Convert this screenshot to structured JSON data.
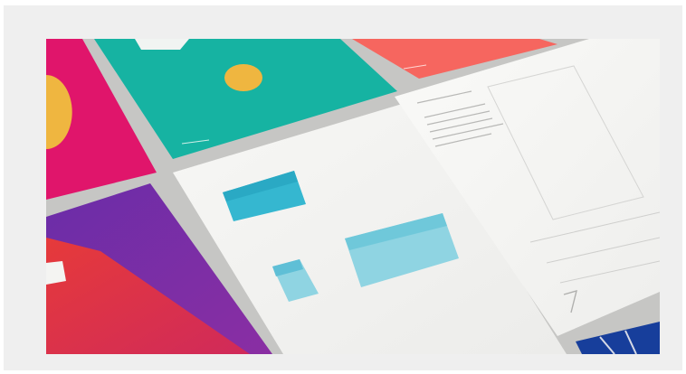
{
  "image": {
    "alt": "",
    "colors": {
      "frame": "#efefef",
      "table": "#c9c9c7",
      "magenta": "#e0156b",
      "yellow": "#efb640",
      "teal": "#16b3a2",
      "coral": "#f6665f",
      "navy": "#173e9b",
      "purple": "#7b2ea7",
      "red": "#e5373c",
      "paper": "#f3f3f1",
      "cyan": "#35b7d0",
      "light_cyan": "#8fd4e2"
    }
  }
}
